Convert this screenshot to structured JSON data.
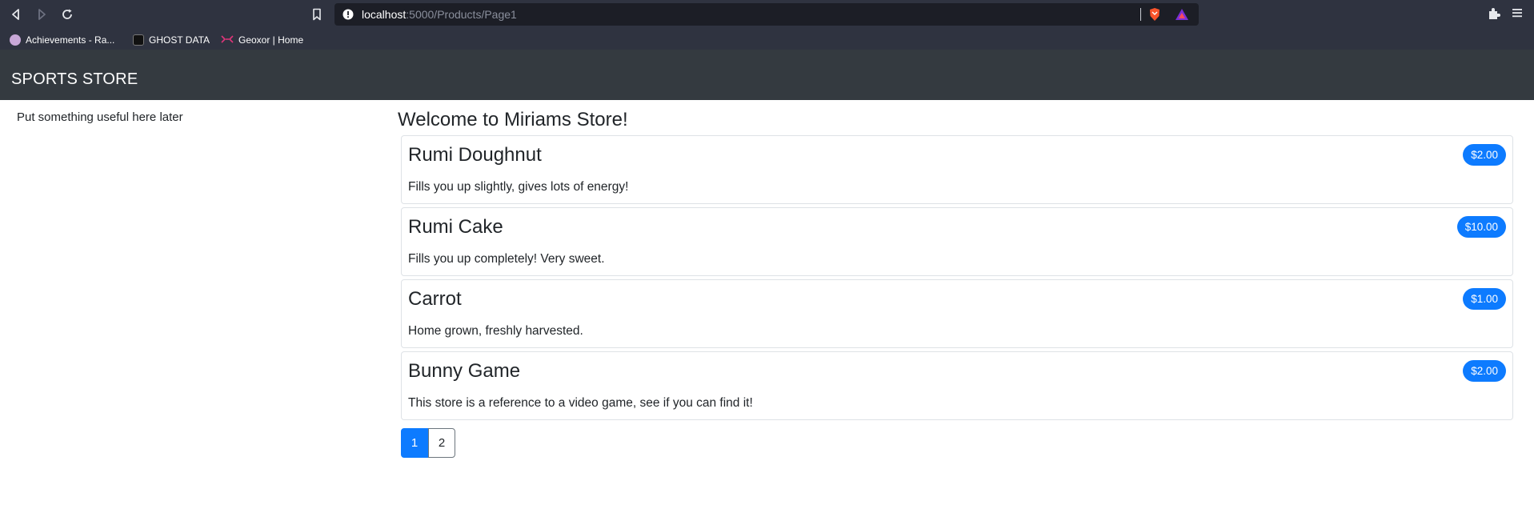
{
  "browser": {
    "url_host": "localhost",
    "url_path": ":5000/Products/Page1",
    "bookmarks": [
      {
        "label": "Achievements - Ra...",
        "icon": "achievements-favicon",
        "color": "#c9a8d8"
      },
      {
        "label": "GHOST DATA",
        "icon": "ghost-data-favicon",
        "color": "#111111"
      },
      {
        "label": "Geoxor | Home",
        "icon": "geoxor-favicon",
        "color": "#e0357a"
      }
    ]
  },
  "navbar": {
    "brand": "SPORTS STORE"
  },
  "sidebar": {
    "note": "Put something useful here later"
  },
  "main": {
    "heading": "Welcome to Miriams Store!",
    "products": [
      {
        "name": "Rumi Doughnut",
        "price": "$2.00",
        "description": "Fills you up slightly, gives lots of energy!"
      },
      {
        "name": "Rumi Cake",
        "price": "$10.00",
        "description": "Fills you up completely! Very sweet."
      },
      {
        "name": "Carrot",
        "price": "$1.00",
        "description": "Home grown, freshly harvested."
      },
      {
        "name": "Bunny Game",
        "price": "$2.00",
        "description": "This store is a reference to a video game, see if you can find it!"
      }
    ],
    "pagination": [
      {
        "label": "1",
        "active": true
      },
      {
        "label": "2",
        "active": false
      }
    ]
  },
  "colors": {
    "primary": "#0d7bff",
    "navbar": "#343a40",
    "chrome": "#2f3340"
  }
}
